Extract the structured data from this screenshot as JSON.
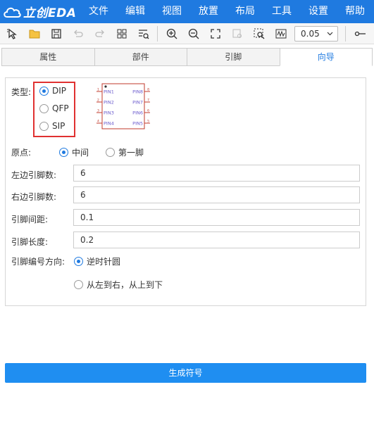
{
  "app": {
    "logo_text": "立创EDA"
  },
  "menu": [
    "文件",
    "编辑",
    "视图",
    "放置",
    "布局",
    "工具",
    "设置",
    "帮助"
  ],
  "toolbar": {
    "zoom_value": "0.05"
  },
  "tabs": [
    {
      "label": "属性",
      "active": false
    },
    {
      "label": "部件",
      "active": false
    },
    {
      "label": "引脚",
      "active": false
    },
    {
      "label": "向导",
      "active": true
    }
  ],
  "form": {
    "type_label": "类型:",
    "type_options": [
      "DIP",
      "QFP",
      "SIP"
    ],
    "type_selected": "DIP",
    "origin_label": "原点:",
    "origin_options": [
      "中间",
      "第一脚"
    ],
    "left_pins_label": "左边引脚数:",
    "left_pins_value": "6",
    "right_pins_label": "右边引脚数:",
    "right_pins_value": "6",
    "pin_spacing_label": "引脚间距:",
    "pin_spacing_value": "0.1",
    "pin_length_label": "引脚长度:",
    "pin_length_value": "0.2",
    "numbering_label": "引脚编号方向:",
    "numbering_options": [
      "逆时针圆",
      "从左到右，从上到下"
    ]
  },
  "preview": {
    "left_pins": [
      "PIN1",
      "PIN2",
      "PIN3",
      "PIN4"
    ],
    "right_pins": [
      "PIN8",
      "PIN7",
      "PIN6",
      "PIN5"
    ],
    "left_nums": [
      "1",
      "2",
      "3",
      "4"
    ],
    "right_nums": [
      "8",
      "7",
      "6",
      "5"
    ],
    "accent_color": "#c0392b",
    "pin_text_color": "#6a5acd"
  },
  "actions": {
    "generate_label": "生成符号"
  },
  "colors": {
    "brand": "#1f7ae0",
    "button": "#1f8ef1",
    "highlight": "#e03131"
  }
}
